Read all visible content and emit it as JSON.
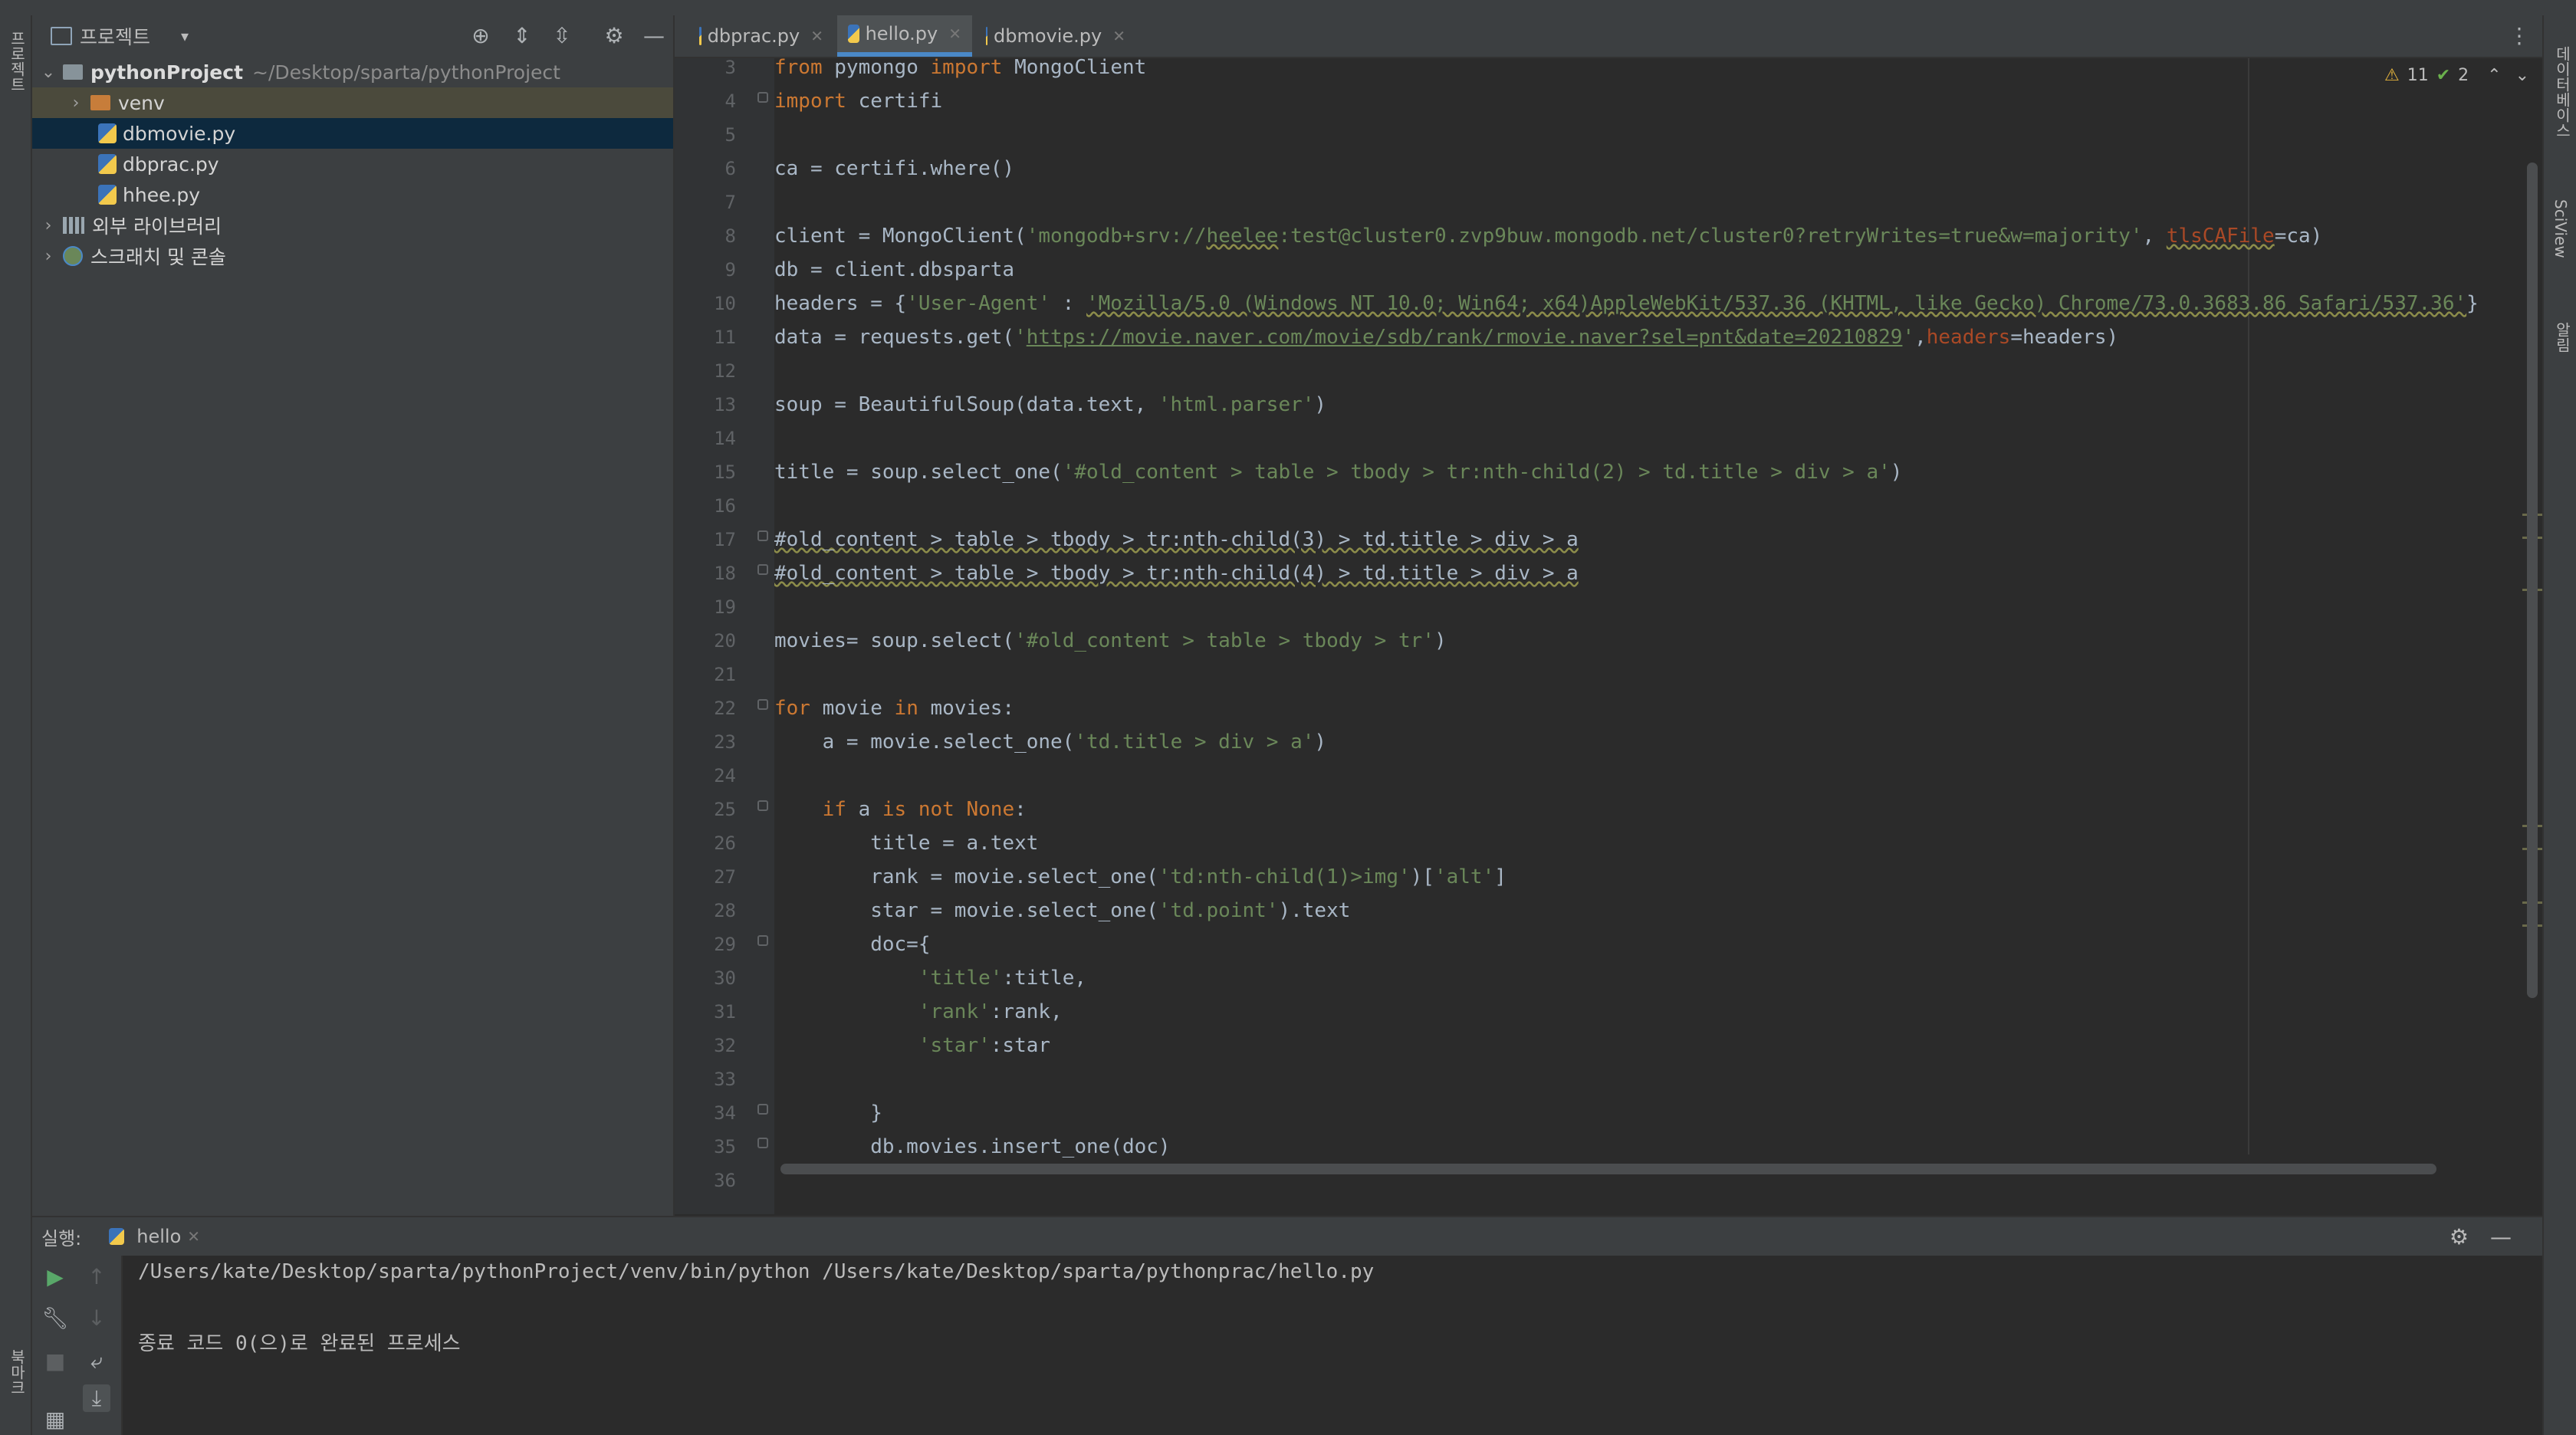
{
  "project_panel": {
    "title": "프로젝트",
    "root_name": "pythonProject",
    "root_path": "~/Desktop/sparta/pythonProject",
    "items": [
      {
        "label": "venv",
        "type": "folder"
      },
      {
        "label": "dbmovie.py",
        "type": "python-file"
      },
      {
        "label": "dbprac.py",
        "type": "python-file"
      },
      {
        "label": "hhee.py",
        "type": "python-file"
      },
      {
        "label": "외부 라이브러리",
        "type": "library"
      },
      {
        "label": "스크래치 및 콘솔",
        "type": "scratch"
      }
    ]
  },
  "tabs": [
    {
      "label": "dbprac.py",
      "active": false
    },
    {
      "label": "hello.py",
      "active": true
    },
    {
      "label": "dbmovie.py",
      "active": false
    }
  ],
  "inspections": {
    "warnings": "11",
    "ok": "2"
  },
  "editor": {
    "line_numbers": [
      "3",
      "4",
      "5",
      "6",
      "7",
      "8",
      "9",
      "10",
      "11",
      "12",
      "13",
      "14",
      "15",
      "16",
      "17",
      "18",
      "19",
      "20",
      "21",
      "22",
      "23",
      "24",
      "25",
      "26",
      "27",
      "28",
      "29",
      "30",
      "31",
      "32",
      "33",
      "34",
      "35",
      "36"
    ]
  },
  "side_labels": {
    "left_top": "프로젝트",
    "left_bottom": "북마크",
    "right_top": "데이터베이스",
    "right_middle": "SciView",
    "right_bottom": "알림"
  },
  "run_panel": {
    "label": "실행:",
    "tab_label": "hello",
    "output": [
      "/Users/kate/Desktop/sparta/pythonProject/venv/bin/python /Users/kate/Desktop/sparta/pythonprac/hello.py",
      "",
      "종료 코드 0(으)로 완료된 프로세스"
    ]
  },
  "colors": {
    "accent": "#4a88c7",
    "selection": "#0d293e",
    "keyword": "#cc7832",
    "string": "#6a8759"
  }
}
